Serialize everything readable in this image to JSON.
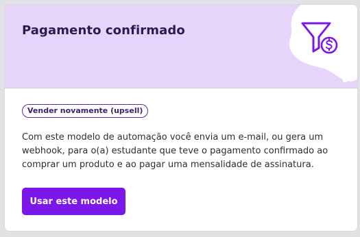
{
  "card": {
    "title": "Pagamento confirmado",
    "icon": "funnel-dollar-icon",
    "tag": "Vender novamente (upsell)",
    "description": "Com este modelo de automação você envia um e-mail, ou gera um webhook, para o(a) estudante que teve o pagamento confirmado ao comprar um produto e ao pagar uma mensalidade de assinatura.",
    "button_label": "Usar este modelo"
  },
  "colors": {
    "header_bg": "#e6d4fb",
    "accent": "#7b17e8",
    "title": "#2d1a4f"
  }
}
